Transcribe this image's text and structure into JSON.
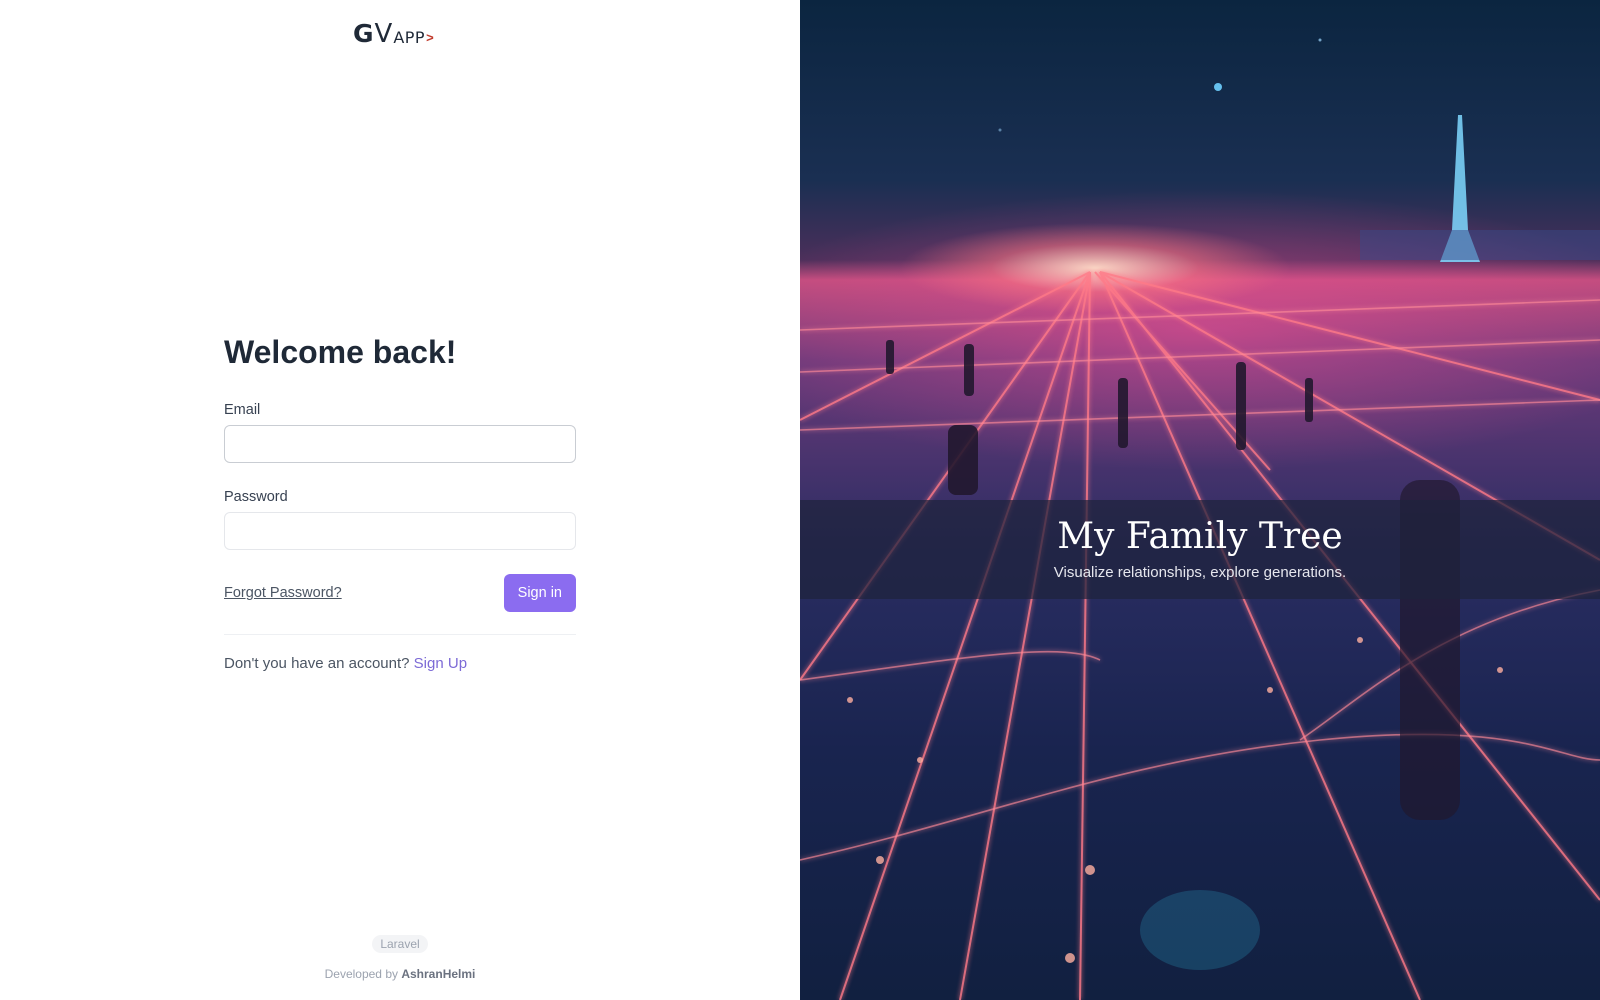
{
  "logo": {
    "g": "G",
    "v": "V",
    "app": "APP",
    "arrow": ">"
  },
  "login": {
    "title": "Welcome back!",
    "email_label": "Email",
    "email_value": "",
    "password_label": "Password",
    "password_value": "",
    "forgot_label": "Forgot Password?",
    "signin_label": "Sign in",
    "no_account_text": "Don't you have an account?",
    "signup_label": "Sign Up"
  },
  "footer": {
    "badge": "Laravel",
    "developed_by": "Developed by",
    "author": "AshranHelmi"
  },
  "hero": {
    "title": "My Family Tree",
    "subtitle": "Visualize relationships, explore generations."
  },
  "colors": {
    "accent": "#8b6cf0",
    "link": "#7c6ad6",
    "banner_overlay": "#1e233c",
    "neon_line": "#ff6a7a"
  }
}
